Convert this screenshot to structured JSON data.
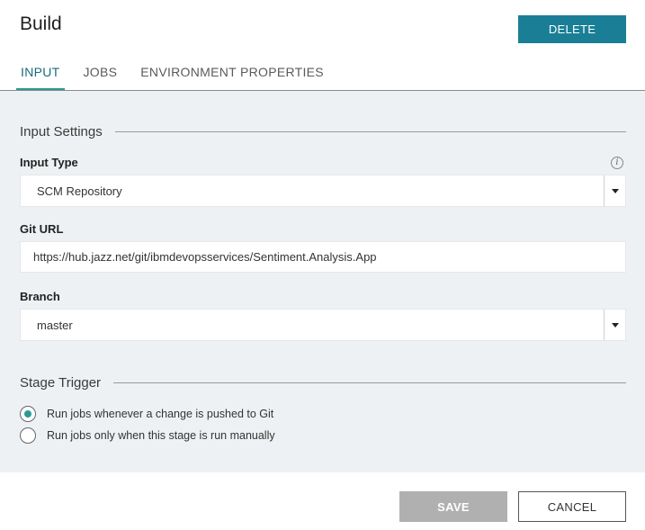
{
  "header": {
    "title": "Build",
    "delete_label": "DELETE"
  },
  "tabs": [
    {
      "label": "INPUT",
      "active": true
    },
    {
      "label": "JOBS",
      "active": false
    },
    {
      "label": "ENVIRONMENT PROPERTIES",
      "active": false
    }
  ],
  "input_settings": {
    "heading": "Input Settings",
    "input_type": {
      "label": "Input Type",
      "value": "SCM Repository",
      "info_icon": "info-icon"
    },
    "git_url": {
      "label": "Git URL",
      "value": "https://hub.jazz.net/git/ibmdevopsservices/Sentiment.Analysis.App"
    },
    "branch": {
      "label": "Branch",
      "value": "master"
    }
  },
  "stage_trigger": {
    "heading": "Stage Trigger",
    "options": [
      {
        "label": "Run jobs whenever a change is pushed to Git",
        "selected": true
      },
      {
        "label": "Run jobs only when this stage is run manually",
        "selected": false
      }
    ]
  },
  "footer": {
    "save_label": "SAVE",
    "cancel_label": "CANCEL"
  },
  "colors": {
    "accent": "#1a7f96",
    "tab_underline": "#2a9b92",
    "panel_bg": "#eef1f3",
    "save_disabled": "#b0b0b0"
  }
}
